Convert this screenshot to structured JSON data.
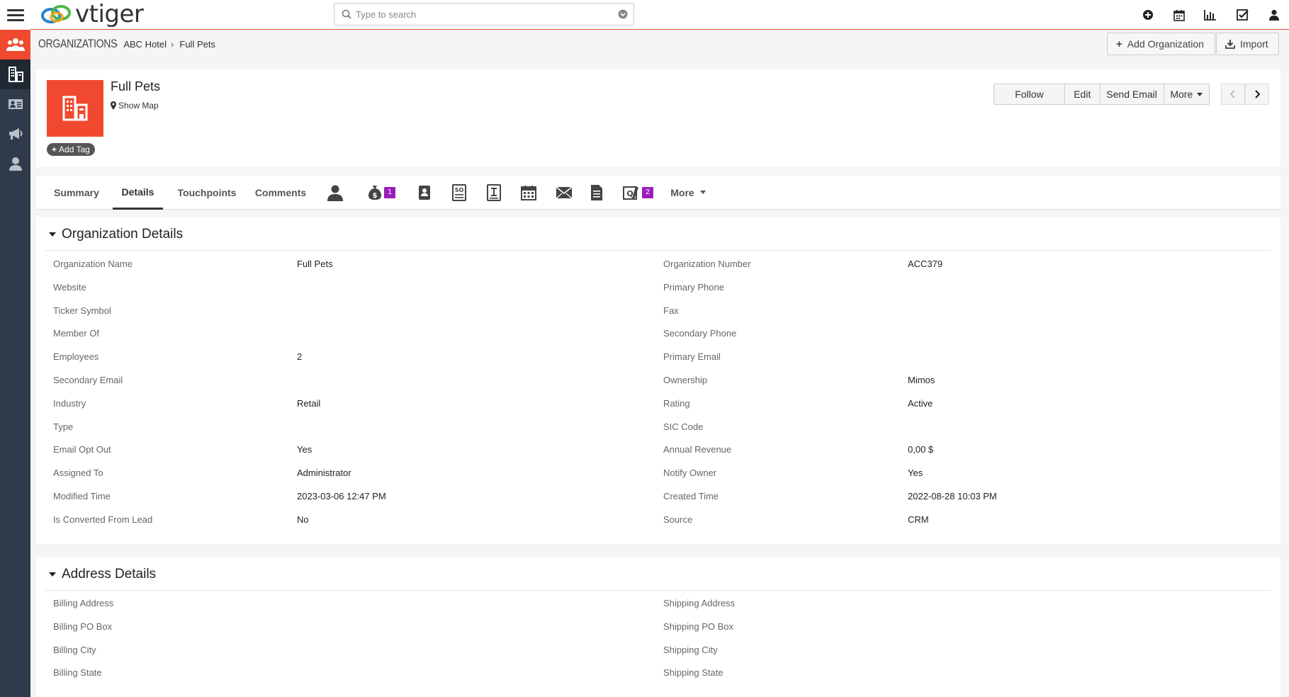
{
  "brand": {
    "logo_text": "vtiger",
    "accent": "#f0492f",
    "rail_bg": "#2f3b4a"
  },
  "search": {
    "placeholder": "Type to search"
  },
  "topbar_icons": [
    "add-icon",
    "calendar-icon",
    "reports-icon",
    "tasks-icon",
    "user-icon"
  ],
  "rail_icons": [
    "contacts-icon",
    "organizations-icon",
    "vcard-icon",
    "megaphone-icon",
    "person-icon"
  ],
  "breadcrumb": {
    "module": "ORGANIZATIONS",
    "parent": "ABC Hotel",
    "current": "Full Pets"
  },
  "header_buttons": {
    "add": "Add Organization",
    "import": "Import"
  },
  "record": {
    "name": "Full Pets",
    "show_map": "Show Map",
    "add_tag": "Add Tag"
  },
  "actions": {
    "follow": "Follow",
    "edit": "Edit",
    "send_email": "Send Email",
    "more": "More"
  },
  "tabs": {
    "summary": "Summary",
    "details": "Details",
    "touchpoints": "Touchpoints",
    "comments": "Comments",
    "more": "More",
    "potentials_badge": "1",
    "quotes_badge": "2"
  },
  "org_details": {
    "title": "Organization Details",
    "rows": [
      {
        "l1": "Organization Name",
        "v1": "Full Pets",
        "l2": "Organization Number",
        "v2": "ACC379"
      },
      {
        "l1": "Website",
        "v1": "",
        "l2": "Primary Phone",
        "v2": ""
      },
      {
        "l1": "Ticker Symbol",
        "v1": "",
        "l2": "Fax",
        "v2": ""
      },
      {
        "l1": "Member Of",
        "v1": "",
        "l2": "Secondary Phone",
        "v2": ""
      },
      {
        "l1": "Employees",
        "v1": "2",
        "l2": "Primary Email",
        "v2": ""
      },
      {
        "l1": "Secondary Email",
        "v1": "",
        "l2": "Ownership",
        "v2": "Mimos"
      },
      {
        "l1": "Industry",
        "v1": "Retail",
        "l2": "Rating",
        "v2": "Active"
      },
      {
        "l1": "Type",
        "v1": "",
        "l2": "SIC Code",
        "v2": ""
      },
      {
        "l1": "Email Opt Out",
        "v1": "Yes",
        "l2": "Annual Revenue",
        "v2": "0,00 $"
      },
      {
        "l1": "Assigned To",
        "v1": "Administrator",
        "l2": "Notify Owner",
        "v2": "Yes"
      },
      {
        "l1": "Modified Time",
        "v1": "2023-03-06 12:47 PM",
        "l2": "Created Time",
        "v2": "2022-08-28 10:03 PM"
      },
      {
        "l1": "Is Converted From Lead",
        "v1": "No",
        "l2": "Source",
        "v2": "CRM"
      }
    ]
  },
  "address_details": {
    "title": "Address Details",
    "rows": [
      {
        "l1": "Billing Address",
        "v1": "",
        "l2": "Shipping Address",
        "v2": ""
      },
      {
        "l1": "Billing PO Box",
        "v1": "",
        "l2": "Shipping PO Box",
        "v2": ""
      },
      {
        "l1": "Billing City",
        "v1": "",
        "l2": "Shipping City",
        "v2": ""
      },
      {
        "l1": "Billing State",
        "v1": "",
        "l2": "Shipping State",
        "v2": ""
      }
    ]
  }
}
